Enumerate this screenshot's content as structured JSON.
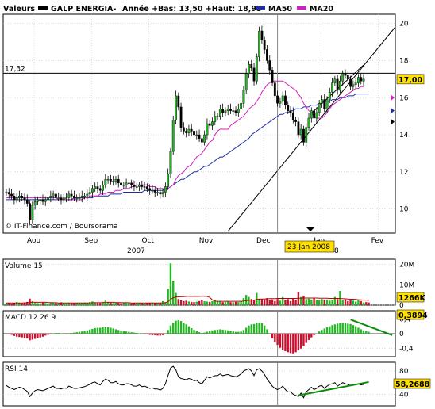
{
  "chart_data": {
    "type": "candlestick",
    "header": {
      "label": "Valeurs",
      "symbol": "GALP ENERGIA-",
      "stats": "Année +Bas: 13,50 +Haut: 18,95",
      "legend": [
        {
          "name": "MA50",
          "color": "#1f2fa0"
        },
        {
          "name": "MA20",
          "color": "#d020c0"
        }
      ]
    },
    "source": "© IT-Finance.com / Boursorama",
    "x_months": [
      "Aou",
      "Sep",
      "Oct",
      "Nov",
      "Dec",
      "Jan",
      "Fev"
    ],
    "x_year": "2007",
    "x_year2": "8",
    "crosshair_date": "23 Jan 2008",
    "ref_line": {
      "value": 17.32,
      "label": "17,32"
    },
    "last_price": {
      "value": 17.0,
      "label": "17,00"
    },
    "price_axis": {
      "ticks": [
        10,
        12,
        14,
        16,
        18,
        20
      ],
      "ylim": [
        8.7,
        20.5
      ]
    },
    "closes": [
      10.9,
      10.8,
      10.7,
      10.5,
      10.6,
      10.7,
      10.6,
      10.5,
      10.3,
      9.4,
      10.2,
      10.4,
      10.5,
      10.5,
      10.4,
      10.5,
      10.6,
      10.7,
      10.8,
      10.6,
      10.6,
      10.5,
      10.6,
      10.6,
      10.8,
      10.7,
      10.6,
      10.6,
      10.6,
      10.7,
      10.7,
      10.8,
      10.9,
      11.1,
      11.2,
      11.1,
      11.0,
      11.3,
      11.6,
      11.6,
      11.5,
      11.5,
      11.6,
      11.4,
      11.3,
      11.3,
      11.4,
      11.4,
      11.3,
      11.2,
      11.2,
      11.3,
      11.2,
      11.2,
      11.1,
      11.0,
      11.0,
      10.9,
      10.9,
      10.8,
      10.9,
      11.2,
      11.9,
      13.1,
      14.8,
      16.1,
      15.5,
      14.4,
      14.2,
      14.1,
      14.3,
      14.2,
      14.0,
      14.0,
      13.8,
      13.6,
      14.0,
      14.6,
      14.5,
      14.7,
      15.0,
      15.0,
      15.4,
      15.2,
      15.3,
      15.4,
      15.3,
      15.3,
      15.2,
      15.4,
      15.7,
      16.4,
      17.3,
      17.8,
      17.6,
      16.9,
      18.2,
      19.6,
      19.1,
      18.6,
      18.0,
      17.5,
      16.8,
      16.1,
      15.7,
      15.8,
      16.1,
      15.6,
      15.3,
      15.2,
      14.8,
      14.7,
      14.0,
      14.3,
      13.6,
      14.4,
      14.9,
      15.3,
      14.9,
      15.2,
      15.7,
      15.9,
      15.4,
      15.9,
      16.3,
      16.8,
      17.0,
      16.4,
      16.9,
      17.3,
      17.2,
      17.0,
      16.6,
      16.7,
      16.8,
      17.1,
      16.9,
      17.0
    ],
    "ma20": [
      10.6,
      10.6,
      10.6,
      10.6,
      10.6,
      10.6,
      10.6,
      10.6,
      10.6,
      10.6,
      10.6,
      10.6,
      10.6,
      10.6,
      10.6,
      10.6,
      10.6,
      10.6,
      10.6,
      10.6,
      10.5,
      10.5,
      10.5,
      10.5,
      10.5,
      10.5,
      10.5,
      10.5,
      10.5,
      10.5,
      10.6,
      10.6,
      10.7,
      10.7,
      10.7,
      10.7,
      10.8,
      10.8,
      10.8,
      10.9,
      10.9,
      10.9,
      11.0,
      11.0,
      11.0,
      11.1,
      11.1,
      11.1,
      11.2,
      11.2,
      11.3,
      11.3,
      11.3,
      11.3,
      11.3,
      11.2,
      11.2,
      11.2,
      11.1,
      11.1,
      11.1,
      11.1,
      11.1,
      11.2,
      11.3,
      11.6,
      11.8,
      11.9,
      12.0,
      12.2,
      12.3,
      12.4,
      12.6,
      12.8,
      12.9,
      13.0,
      13.2,
      13.4,
      13.6,
      13.7,
      14.0,
      14.2,
      14.3,
      14.3,
      14.3,
      14.3,
      14.5,
      14.6,
      14.7,
      14.8,
      14.9,
      15.0,
      15.2,
      15.4,
      15.5,
      15.6,
      15.8,
      16.0,
      16.3,
      16.5,
      16.7,
      16.8,
      16.9,
      16.9,
      16.9,
      16.9,
      16.9,
      16.8,
      16.7,
      16.6,
      16.5,
      16.4,
      16.2,
      16.0,
      15.7,
      15.5,
      15.3,
      15.2,
      15.0,
      14.9,
      14.9,
      14.9,
      15.0,
      15.2,
      15.4,
      15.6,
      15.7,
      15.8,
      15.9,
      16.0,
      16.1,
      16.2,
      16.3,
      16.4,
      16.5,
      16.5,
      16.6,
      16.6
    ],
    "ma50": [
      10.5,
      10.5,
      10.5,
      10.5,
      10.5,
      10.5,
      10.5,
      10.5,
      10.5,
      10.5,
      10.5,
      10.5,
      10.5,
      10.5,
      10.5,
      10.5,
      10.5,
      10.5,
      10.5,
      10.5,
      10.5,
      10.5,
      10.5,
      10.5,
      10.5,
      10.5,
      10.6,
      10.6,
      10.6,
      10.6,
      10.6,
      10.6,
      10.6,
      10.6,
      10.7,
      10.7,
      10.7,
      10.7,
      10.7,
      10.7,
      10.8,
      10.8,
      10.8,
      10.8,
      10.8,
      10.9,
      10.9,
      10.9,
      10.9,
      10.9,
      10.9,
      10.9,
      10.9,
      11.0,
      11.0,
      11.0,
      11.0,
      11.0,
      11.0,
      11.0,
      11.0,
      11.1,
      11.1,
      11.2,
      11.3,
      11.4,
      11.5,
      11.6,
      11.6,
      11.7,
      11.8,
      11.9,
      12.0,
      12.0,
      12.1,
      12.2,
      12.3,
      12.3,
      12.4,
      12.5,
      12.6,
      12.7,
      12.8,
      12.8,
      12.9,
      13.0,
      13.1,
      13.2,
      13.3,
      13.4,
      13.5,
      13.6,
      13.7,
      13.8,
      14.0,
      14.1,
      14.2,
      14.3,
      14.4,
      14.5,
      14.6,
      14.7,
      14.8,
      14.9,
      15.0,
      15.1,
      15.1,
      15.2,
      15.2,
      15.3,
      15.3,
      15.4,
      15.4,
      15.4,
      15.5,
      15.5,
      15.5,
      15.6,
      15.6,
      15.6,
      15.7,
      15.7,
      15.8,
      15.8,
      15.8,
      15.9,
      15.9,
      15.9,
      16.0,
      16.0,
      16.0,
      16.1,
      16.1,
      16.1,
      16.2,
      16.2,
      16.2,
      16.2,
      16.2,
      16.2
    ],
    "right_markers": [
      {
        "value": 16.0,
        "color": "#d020c0",
        "shape": "arrow"
      },
      {
        "value": 15.3,
        "color": "#1f2fa0",
        "shape": "arrow"
      },
      {
        "value": 14.7,
        "color": "#000000",
        "shape": "arrow"
      }
    ],
    "volume": {
      "label": "Volume 15",
      "ticks": [
        {
          "v": 0,
          "t": "0"
        },
        {
          "v": 10,
          "t": "10M"
        },
        {
          "v": 20,
          "t": "20M"
        }
      ],
      "ylim": [
        0,
        21
      ],
      "last_label": "1266K",
      "values": [
        1.0,
        1.2,
        0.8,
        1.1,
        1.5,
        1.0,
        0.9,
        1.3,
        1.6,
        3.2,
        2.0,
        1.1,
        1.0,
        0.9,
        1.2,
        1.0,
        0.8,
        1.1,
        1.3,
        1.0,
        0.9,
        1.4,
        1.0,
        0.8,
        1.2,
        1.1,
        0.9,
        1.0,
        1.2,
        1.0,
        1.3,
        1.1,
        1.5,
        1.8,
        1.4,
        1.1,
        1.0,
        1.6,
        2.2,
        1.5,
        1.2,
        1.0,
        1.3,
        1.1,
        0.9,
        1.2,
        1.0,
        1.1,
        0.9,
        1.0,
        1.2,
        1.0,
        0.9,
        1.1,
        1.0,
        1.2,
        1.3,
        1.0,
        1.1,
        1.2,
        2.0,
        1.5,
        8.0,
        20.5,
        12.0,
        6.0,
        3.0,
        2.5,
        2.0,
        2.2,
        1.8,
        1.6,
        1.5,
        1.7,
        2.0,
        2.5,
        1.9,
        1.8,
        1.6,
        2.0,
        2.3,
        1.8,
        1.7,
        1.5,
        1.6,
        1.8,
        1.5,
        1.4,
        1.6,
        1.5,
        2.0,
        3.5,
        5.0,
        4.0,
        3.0,
        2.5,
        6.0,
        3.2,
        3.0,
        2.8,
        3.5,
        2.5,
        2.8,
        2.0,
        3.0,
        2.2,
        4.0,
        2.5,
        3.0,
        2.0,
        3.5,
        2.5,
        6.5,
        4.0,
        4.5,
        3.0,
        3.2,
        2.8,
        3.5,
        2.6,
        2.4,
        3.0,
        2.5,
        2.8,
        2.2,
        2.6,
        4.0,
        3.0,
        7.0,
        2.5,
        2.8,
        2.0,
        2.4,
        2.2,
        1.8,
        2.5,
        2.0,
        1.3,
        1.5,
        1.3
      ],
      "ma": [
        1.1,
        1.1,
        1.1,
        1.1,
        1.1,
        1.1,
        1.1,
        1.1,
        1.2,
        1.3,
        1.4,
        1.4,
        1.4,
        1.4,
        1.4,
        1.4,
        1.3,
        1.3,
        1.2,
        1.2,
        1.1,
        1.1,
        1.1,
        1.1,
        1.1,
        1.1,
        1.1,
        1.1,
        1.1,
        1.1,
        1.1,
        1.1,
        1.1,
        1.2,
        1.2,
        1.2,
        1.2,
        1.3,
        1.3,
        1.4,
        1.4,
        1.4,
        1.3,
        1.3,
        1.3,
        1.2,
        1.2,
        1.2,
        1.1,
        1.1,
        1.1,
        1.1,
        1.1,
        1.1,
        1.1,
        1.1,
        1.1,
        1.1,
        1.1,
        1.1,
        1.1,
        1.2,
        1.7,
        2.9,
        3.6,
        4.0,
        4.1,
        4.2,
        4.2,
        4.3,
        4.3,
        4.3,
        4.3,
        4.3,
        4.3,
        4.4,
        4.4,
        4.3,
        3.8,
        2.6,
        2.0,
        1.9,
        1.9,
        1.9,
        1.9,
        1.9,
        1.9,
        1.9,
        1.9,
        1.9,
        1.9,
        2.0,
        2.2,
        2.4,
        2.5,
        2.5,
        2.8,
        2.9,
        3.0,
        3.0,
        3.1,
        3.2,
        3.2,
        3.2,
        3.3,
        3.3,
        3.3,
        3.3,
        3.3,
        3.3,
        3.3,
        3.3,
        3.4,
        3.4,
        3.5,
        3.5,
        3.5,
        3.5,
        3.5,
        3.5,
        3.4,
        3.4,
        3.4,
        3.4,
        3.3,
        3.3,
        3.3,
        3.3,
        3.3,
        3.2,
        3.1,
        3.0,
        2.9,
        2.9,
        2.8,
        2.7,
        2.6,
        2.5,
        2.5,
        2.4
      ]
    },
    "macd": {
      "label": "MACD 12 26 9",
      "ticks": [
        {
          "v": 0.4,
          "t": "0,4"
        },
        {
          "v": 0,
          "t": "0"
        },
        {
          "v": -0.4,
          "t": "-0,4"
        }
      ],
      "ylim": [
        -0.62,
        0.62
      ],
      "last_label": "0,3894",
      "values": [
        0.0,
        -0.02,
        -0.03,
        -0.06,
        -0.08,
        -0.09,
        -0.1,
        -0.12,
        -0.13,
        -0.18,
        -0.16,
        -0.14,
        -0.12,
        -0.1,
        -0.08,
        -0.05,
        -0.03,
        -0.01,
        0.01,
        0.02,
        0.02,
        0.01,
        0.0,
        -0.01,
        0.0,
        0.02,
        0.03,
        0.04,
        0.05,
        0.06,
        0.08,
        0.09,
        0.11,
        0.13,
        0.15,
        0.16,
        0.16,
        0.17,
        0.18,
        0.17,
        0.16,
        0.14,
        0.12,
        0.1,
        0.08,
        0.07,
        0.06,
        0.05,
        0.04,
        0.03,
        0.02,
        0.01,
        0.0,
        -0.01,
        -0.02,
        -0.03,
        -0.04,
        -0.04,
        -0.05,
        -0.05,
        -0.04,
        0.0,
        0.1,
        0.22,
        0.3,
        0.35,
        0.36,
        0.34,
        0.3,
        0.25,
        0.2,
        0.15,
        0.1,
        0.07,
        0.04,
        0.02,
        0.03,
        0.05,
        0.07,
        0.09,
        0.1,
        0.11,
        0.12,
        0.11,
        0.1,
        0.09,
        0.08,
        0.06,
        0.05,
        0.05,
        0.06,
        0.1,
        0.16,
        0.22,
        0.25,
        0.26,
        0.29,
        0.3,
        0.28,
        0.22,
        0.12,
        0.0,
        -0.12,
        -0.22,
        -0.3,
        -0.38,
        -0.43,
        -0.47,
        -0.5,
        -0.52,
        -0.53,
        -0.5,
        -0.45,
        -0.4,
        -0.33,
        -0.25,
        -0.17,
        -0.1,
        -0.04,
        0.01,
        0.06,
        0.1,
        0.14,
        0.17,
        0.2,
        0.23,
        0.25,
        0.27,
        0.28,
        0.29,
        0.28,
        0.27,
        0.26,
        0.23,
        0.2,
        0.16,
        0.12,
        0.09,
        0.07,
        0.05
      ],
      "trend": {
        "from": [
          132,
          0.38
        ],
        "to": [
          148,
          -0.04
        ]
      }
    },
    "rsi": {
      "label": "RSI 14",
      "ticks": [
        {
          "v": 80,
          "t": "80"
        },
        {
          "v": 40,
          "t": "40"
        }
      ],
      "ylim": [
        20,
        95
      ],
      "last_label": "58,2688",
      "values": [
        55,
        52,
        50,
        48,
        50,
        52,
        51,
        48,
        45,
        36,
        42,
        46,
        48,
        47,
        46,
        48,
        50,
        52,
        54,
        50,
        50,
        49,
        51,
        50,
        54,
        52,
        50,
        50,
        51,
        52,
        53,
        55,
        57,
        60,
        61,
        58,
        56,
        62,
        66,
        64,
        60,
        60,
        62,
        58,
        56,
        56,
        58,
        58,
        56,
        54,
        54,
        56,
        53,
        54,
        52,
        50,
        51,
        49,
        49,
        47,
        50,
        58,
        72,
        85,
        88,
        82,
        70,
        67,
        66,
        65,
        67,
        66,
        63,
        64,
        60,
        58,
        64,
        70,
        68,
        70,
        72,
        72,
        75,
        72,
        73,
        74,
        72,
        71,
        70,
        72,
        75,
        80,
        82,
        84,
        80,
        72,
        82,
        84,
        80,
        74,
        66,
        60,
        54,
        50,
        48,
        50,
        54,
        48,
        44,
        44,
        40,
        38,
        36,
        42,
        34,
        44,
        48,
        52,
        48,
        50,
        54,
        55,
        50,
        54,
        57,
        58,
        60,
        54,
        57,
        60,
        58,
        57,
        55,
        56,
        57,
        58,
        56,
        57
      ],
      "trend": {
        "from": [
          112,
          38
        ],
        "to": [
          139,
          61
        ]
      }
    },
    "months_at": [
      0,
      22,
      44,
      66,
      88,
      110,
      132
    ],
    "crosshair_index": 104
  }
}
